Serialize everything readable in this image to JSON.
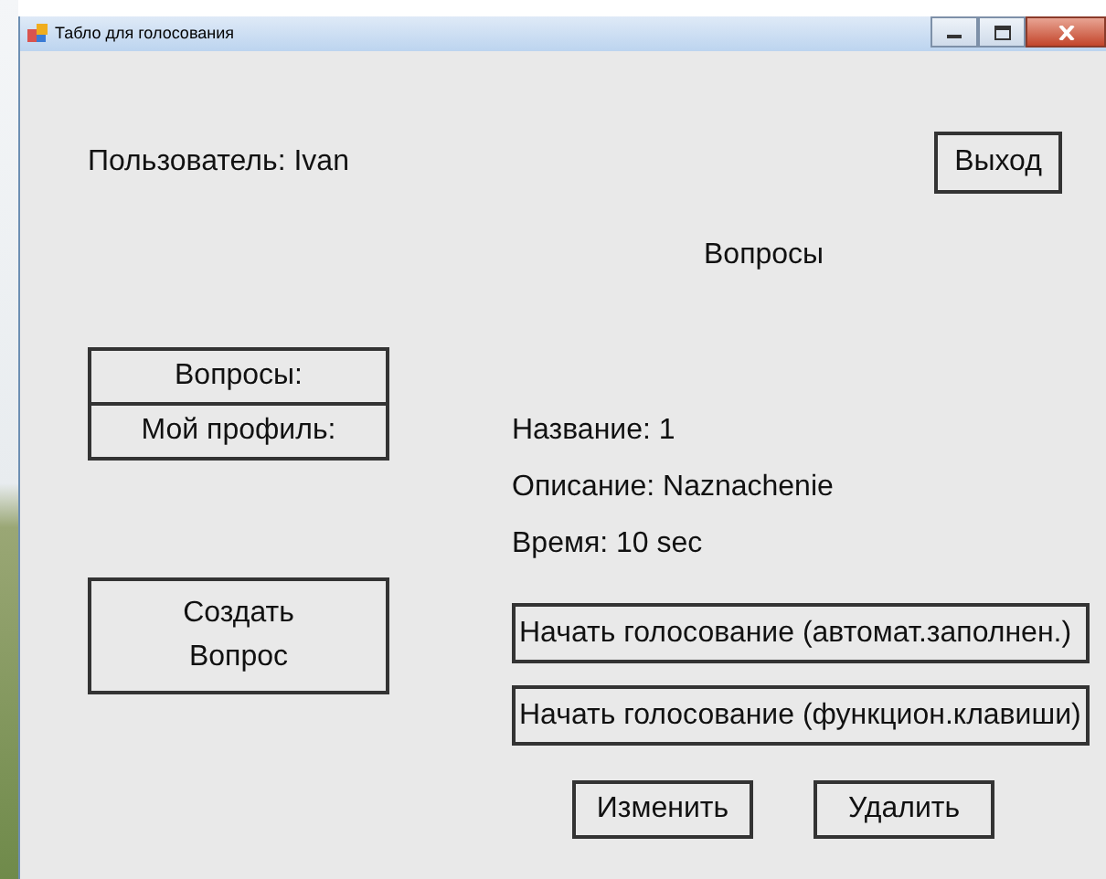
{
  "window": {
    "title": "Табло для голосования"
  },
  "user_label": "Пользователь: Ivan",
  "exit_button": "Выход",
  "section_title": "Вопросы",
  "nav_buttons": [
    "Вопросы:",
    "Мой профиль:"
  ],
  "create_button": [
    "Создать",
    "Вопрос"
  ],
  "details": [
    "Название: 1",
    "Описание: Naznachenie",
    "Время: 10 sec"
  ],
  "vote_buttons": [
    "Начать голосование (автомат.заполнен.)",
    "Начать голосование (функцион.клавиши)"
  ],
  "action_buttons": [
    "Изменить",
    "Удалить"
  ]
}
